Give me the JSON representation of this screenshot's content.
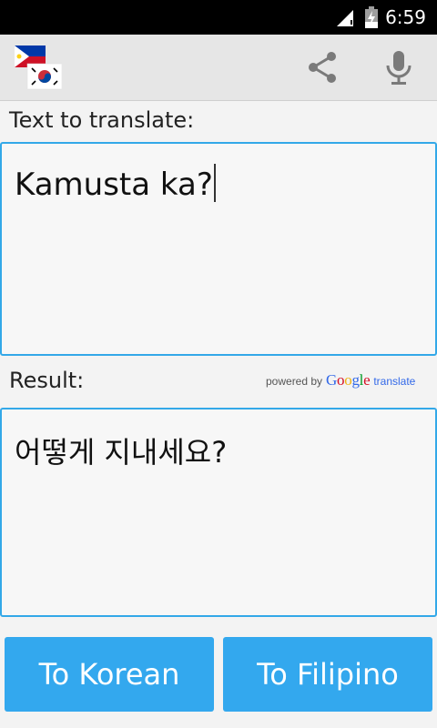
{
  "status_bar": {
    "time": "6:59",
    "icons": [
      "signal-icon",
      "battery-charging-icon"
    ]
  },
  "action_bar": {
    "app_icon": "philippines-korea-flags-icon",
    "actions": [
      "share-icon",
      "microphone-icon"
    ]
  },
  "input": {
    "label": "Text to translate:",
    "value": "Kamusta ka?"
  },
  "result": {
    "label": "Result:",
    "value": "어떻게 지내세요?",
    "attribution": {
      "prefix": "powered by",
      "brand": "Google",
      "suffix": "translate"
    }
  },
  "buttons": {
    "to_korean": "To Korean",
    "to_filipino": "To Filipino"
  },
  "colors": {
    "accent": "#33a8ee",
    "box_border": "#33a8e8",
    "action_bar": "#e6e6e6",
    "background": "#f3f3f3"
  }
}
